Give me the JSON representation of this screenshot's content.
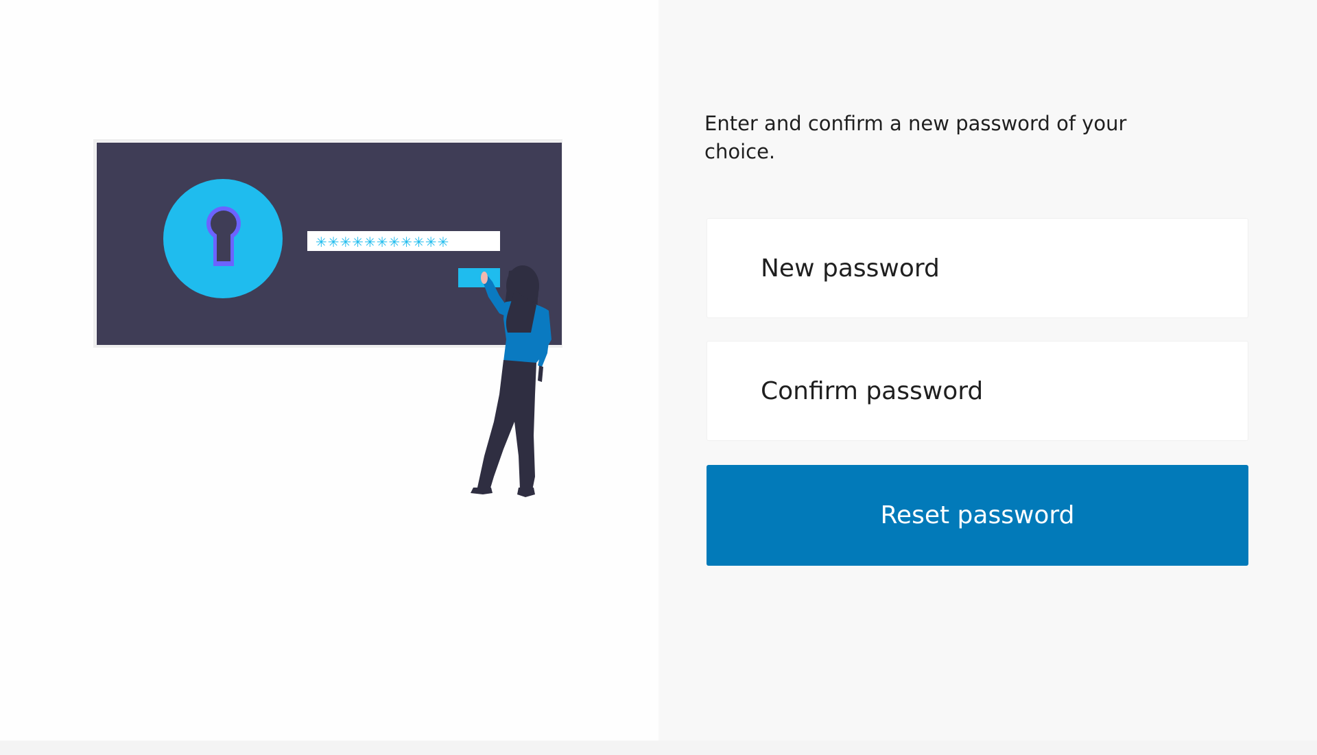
{
  "illustration": {
    "masked_password": "✳✳✳✳✳✳✳✳✳✳✳",
    "colors": {
      "panel": "#3f3d56",
      "accent": "#1fbcee",
      "keyhole_ring": "#6c63ff",
      "shirt": "#0a7ac1",
      "skin": "#f2b8b0"
    }
  },
  "form": {
    "instructions": "Enter and confirm a new password of your choice.",
    "new_password_placeholder": "New password",
    "confirm_password_placeholder": "Confirm password",
    "reset_label": "Reset password"
  },
  "theme": {
    "primary_button": "#027ab9",
    "right_background": "#f8f8f8",
    "text": "#1f1f1f"
  }
}
